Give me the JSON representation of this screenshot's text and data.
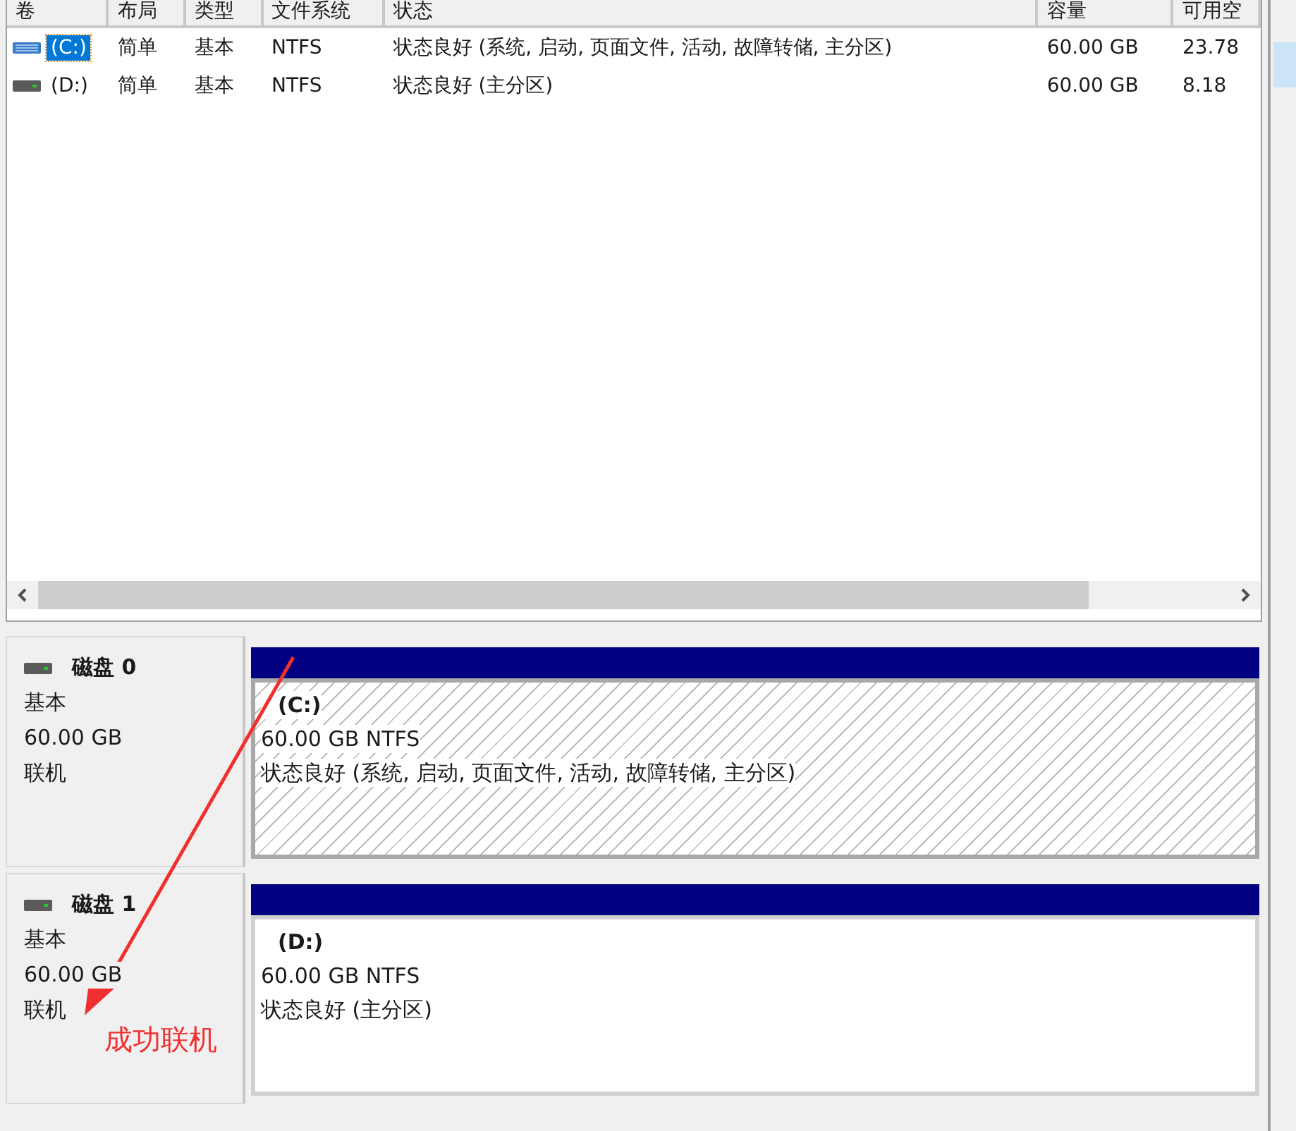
{
  "volume_list": {
    "columns": [
      "卷",
      "布局",
      "类型",
      "文件系统",
      "状态",
      "容量",
      "可用空"
    ],
    "rows": [
      {
        "selected": true,
        "cells": [
          "(C:)",
          "简单",
          "基本",
          "NTFS",
          "状态良好 (系统, 启动, 页面文件, 活动, 故障转储, 主分区)",
          "60.00 GB",
          "23.78"
        ]
      },
      {
        "selected": false,
        "cells": [
          "(D:)",
          "简单",
          "基本",
          "NTFS",
          "状态良好 (主分区)",
          "60.00 GB",
          "8.18"
        ]
      }
    ]
  },
  "disks": [
    {
      "name": "磁盘 0",
      "type": "基本",
      "size": "60.00 GB",
      "status": "联机",
      "partition": {
        "label": "(C:)",
        "size_fs": "60.00 GB NTFS",
        "status": "状态良好 (系统, 启动, 页面文件, 活动, 故障转储, 主分区)",
        "selected": true
      }
    },
    {
      "name": "磁盘 1",
      "type": "基本",
      "size": "60.00 GB",
      "status": "联机",
      "partition": {
        "label": "(D:)",
        "size_fs": "60.00 GB NTFS",
        "status": "状态良好 (主分区)",
        "selected": false
      }
    }
  ],
  "annotation": {
    "text": "成功联机"
  }
}
